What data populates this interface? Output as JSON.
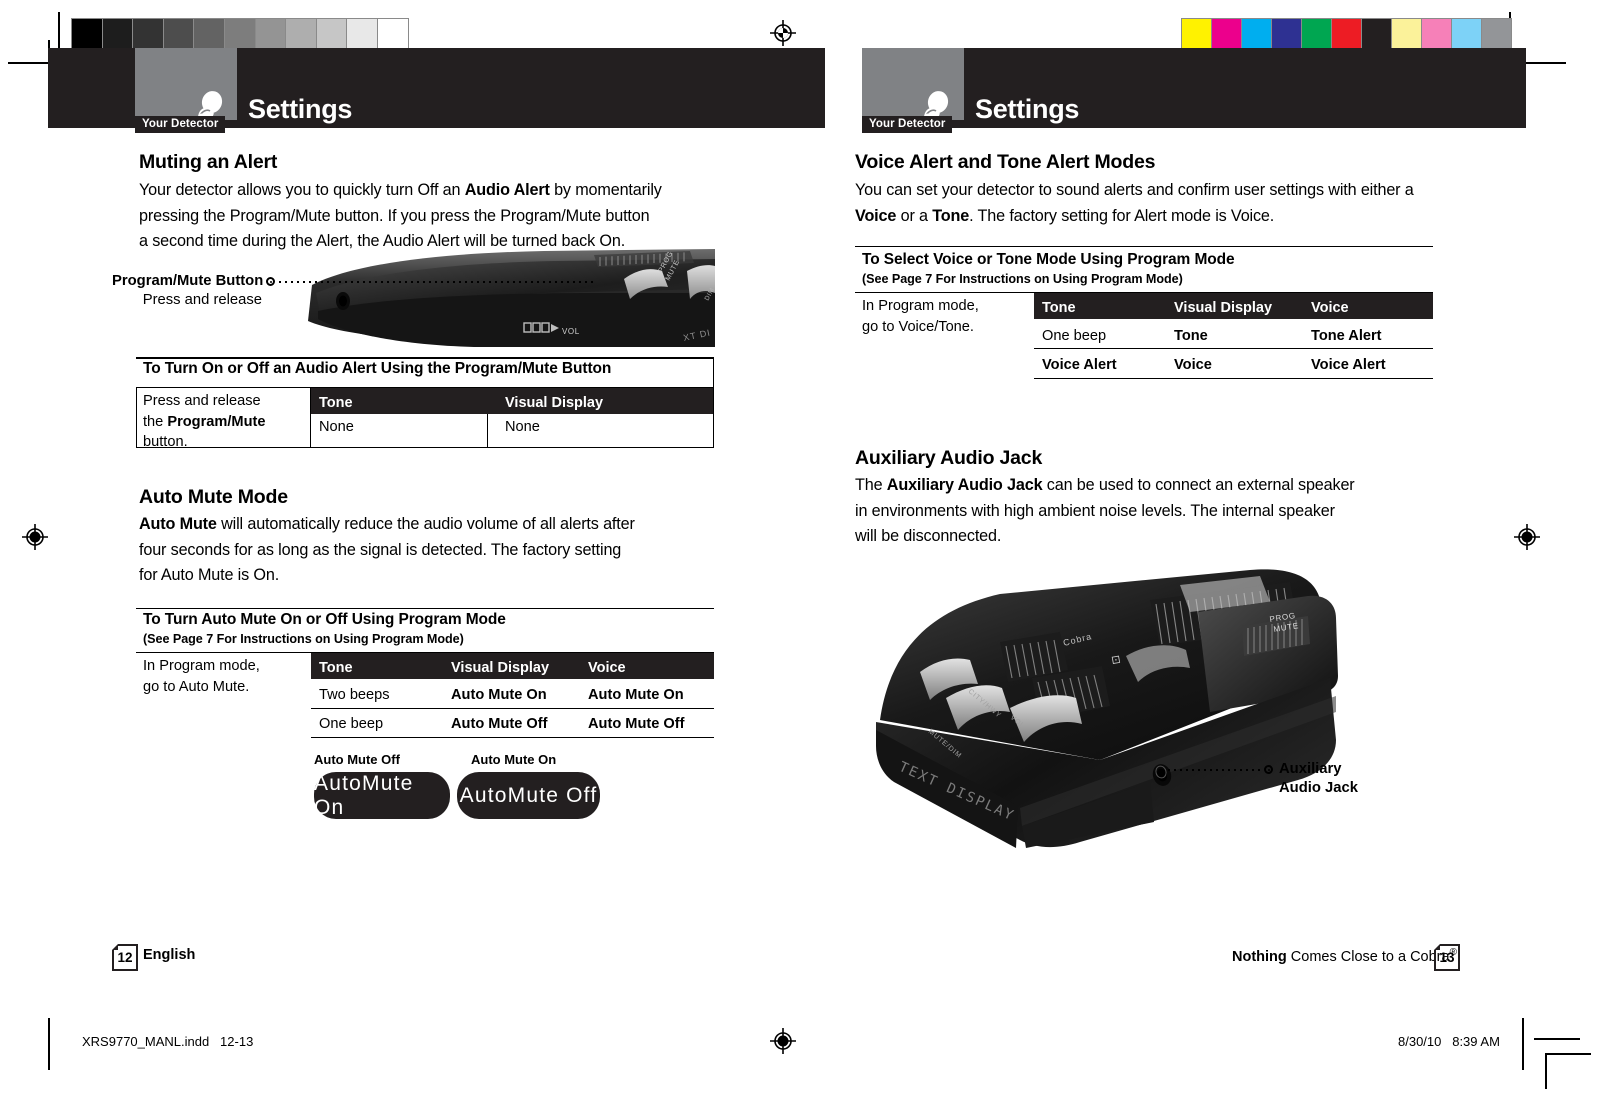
{
  "document": {
    "slug_filename": "XRS9770_MANL.indd",
    "slug_pages": "12-13",
    "slug_date": "8/30/10",
    "slug_time": "8:39 AM"
  },
  "calibration": {
    "gray_swatches": [
      "#000000",
      "#1d1d1d",
      "#333333",
      "#4d4d4d",
      "#636363",
      "#7d7d7d",
      "#949494",
      "#aeaeae",
      "#c6c6c6",
      "#e8e8e8",
      "#ffffff"
    ],
    "color_swatches": [
      "#fff200",
      "#ec008c",
      "#00aeef",
      "#2e3192",
      "#00a651",
      "#ed1c24",
      "#231f20",
      "#fbf29a",
      "#f680b8",
      "#7dd2f7",
      "#939598"
    ]
  },
  "left_page": {
    "header": {
      "tab_label": "Your Detector",
      "title": "Settings",
      "icon": "radar-detector-icon"
    },
    "section1": {
      "heading": "Muting an Alert",
      "body_lines": [
        [
          {
            "t": "Your detector allows you to quickly turn Off an ",
            "b": false
          },
          {
            "t": "Audio Alert",
            "b": true
          },
          {
            "t": " by momentarily",
            "b": false
          }
        ],
        [
          {
            "t": "pressing the Program/Mute button. If you press the Program/Mute button",
            "b": false
          }
        ],
        [
          {
            "t": "a second time during the Alert, the Audio Alert will be turned back On.",
            "b": false
          }
        ]
      ],
      "callout": {
        "title": "Program/Mute Button",
        "sub": "Press and release"
      },
      "table": {
        "title": "To Turn On or Off an Audio Alert Using the Program/Mute Button",
        "side_lines": [
          [
            {
              "t": "Press and release",
              "b": false
            }
          ],
          [
            {
              "t": "the ",
              "b": false
            },
            {
              "t": "Program/Mute",
              "b": true
            }
          ],
          [
            {
              "t": "button.",
              "b": false
            }
          ]
        ],
        "columns": [
          "Tone",
          "Visual Display"
        ],
        "rows": [
          {
            "cells": [
              "None",
              "None"
            ],
            "bold": [
              false,
              false
            ]
          }
        ]
      }
    },
    "section2": {
      "heading": "Auto Mute Mode",
      "body_lines": [
        [
          {
            "t": "Auto Mute",
            "b": true
          },
          {
            "t": " will automatically reduce the audio volume of all alerts after",
            "b": false
          }
        ],
        [
          {
            "t": "four seconds for as long as the signal is detected. The factory setting",
            "b": false
          }
        ],
        [
          {
            "t": "for Auto Mute is On.",
            "b": false
          }
        ]
      ],
      "table": {
        "title": "To Turn Auto Mute On or Off Using Program Mode",
        "subtitle": "(See Page 7 For Instructions on Using Program Mode)",
        "side_lines": [
          [
            {
              "t": "In Program mode,",
              "b": false
            }
          ],
          [
            {
              "t": "go to Auto Mute.",
              "b": false
            }
          ]
        ],
        "columns": [
          "Tone",
          "Visual Display",
          "Voice"
        ],
        "rows": [
          {
            "cells": [
              "Two beeps",
              "Auto Mute On",
              "Auto Mute On"
            ],
            "bold": [
              false,
              true,
              true
            ]
          },
          {
            "cells": [
              "One beep",
              "Auto Mute Off",
              "Auto Mute Off"
            ],
            "bold": [
              false,
              true,
              true
            ]
          }
        ]
      },
      "displays": [
        {
          "label": "Auto Mute Off",
          "screen": "AutoMute On"
        },
        {
          "label": "Auto Mute On",
          "screen": "AutoMute Off"
        }
      ]
    },
    "footer": {
      "page_number": "12",
      "language": "English"
    }
  },
  "right_page": {
    "header": {
      "tab_label": "Your Detector",
      "title": "Settings",
      "icon": "radar-detector-icon"
    },
    "section1": {
      "heading": "Voice Alert and Tone Alert Modes",
      "body_lines": [
        [
          {
            "t": "You can set your detector to sound alerts and confirm user settings with either a",
            "b": false
          }
        ],
        [
          {
            "t": "Voice",
            "b": true
          },
          {
            "t": " or a ",
            "b": false
          },
          {
            "t": "Tone",
            "b": true
          },
          {
            "t": ". The factory setting for Alert mode is Voice.",
            "b": false
          }
        ]
      ],
      "table": {
        "title": "To Select Voice or Tone Mode Using Program Mode",
        "subtitle": "(See Page 7 For Instructions on Using Program Mode)",
        "side_lines": [
          [
            {
              "t": "In Program mode,",
              "b": false
            }
          ],
          [
            {
              "t": "go to Voice/Tone.",
              "b": false
            }
          ]
        ],
        "columns": [
          "Tone",
          "Visual Display",
          "Voice"
        ],
        "rows": [
          {
            "cells": [
              "One beep",
              "Tone",
              "Tone Alert"
            ],
            "bold": [
              false,
              true,
              true
            ]
          },
          {
            "cells": [
              "Voice Alert",
              "Voice",
              "Voice Alert"
            ],
            "bold": [
              true,
              true,
              true
            ]
          }
        ]
      }
    },
    "section2": {
      "heading": "Auxiliary Audio Jack",
      "body_lines": [
        [
          {
            "t": "The ",
            "b": false
          },
          {
            "t": "Auxiliary Audio Jack",
            "b": true
          },
          {
            "t": " can be used to connect an external speaker",
            "b": false
          }
        ],
        [
          {
            "t": "in environments with high ambient noise levels. The internal speaker",
            "b": false
          }
        ],
        [
          {
            "t": "will be disconnected.",
            "b": false
          }
        ]
      ],
      "callout": {
        "line1": "Auxiliary",
        "line2": "Audio Jack"
      },
      "device_label": "TEXT DISPLAY"
    },
    "footer": {
      "tagline_bold": "Nothing",
      "tagline_rest": " Comes Close to a Cobra",
      "tagline_reg": "®",
      "page_number": "13"
    }
  }
}
